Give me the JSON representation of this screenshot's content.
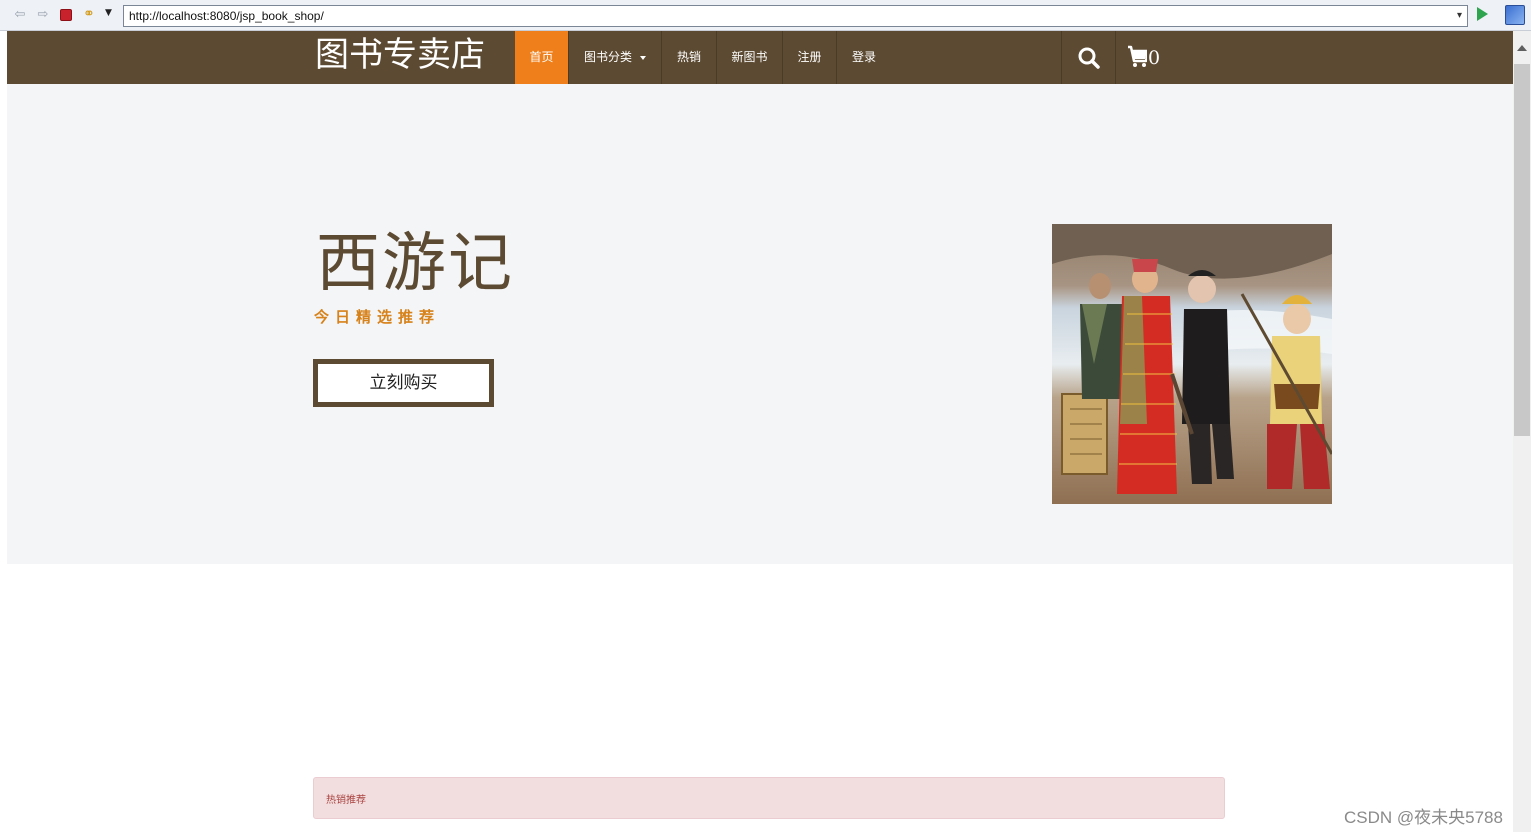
{
  "browser": {
    "url": "http://localhost:8080/jsp_book_shop/"
  },
  "header": {
    "brand": "图书专卖店",
    "nav": [
      {
        "label": "首页",
        "active": true
      },
      {
        "label": "图书分类",
        "dropdown": true
      },
      {
        "label": "热销"
      },
      {
        "label": "新图书"
      },
      {
        "label": "注册"
      },
      {
        "label": "登录"
      }
    ],
    "cart_count": "0",
    "colors": {
      "bar": "#5c4a32",
      "active": "#ef7f1a"
    }
  },
  "hero": {
    "title": "西游记",
    "subtitle": "今日精选推荐",
    "buy_button": "立刻购买"
  },
  "hot_panel": {
    "title": "热销推荐"
  },
  "watermark": "CSDN @夜未央5788"
}
